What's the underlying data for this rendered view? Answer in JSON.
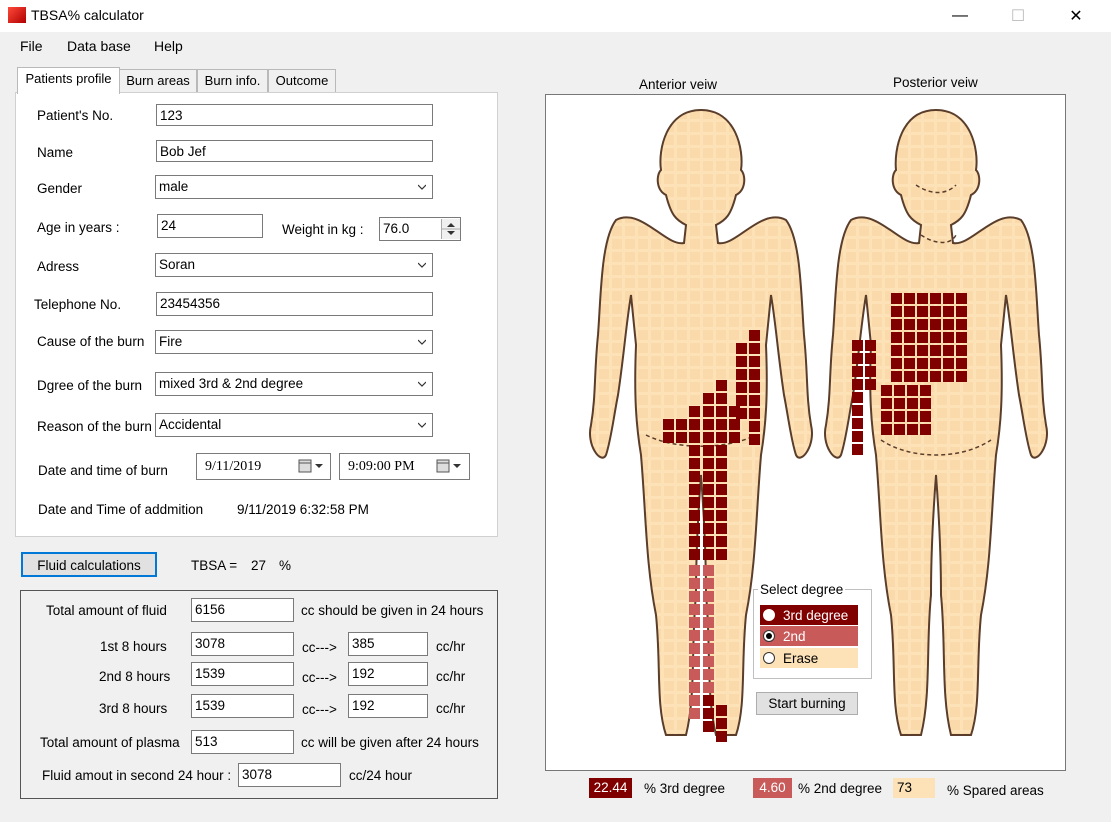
{
  "window": {
    "title": "TBSA% calculator",
    "minimize": "—",
    "maximize": "☐",
    "close": "✕"
  },
  "menu": {
    "file": "File",
    "database": "Data base",
    "help": "Help"
  },
  "tabs": {
    "profile": "Patients profile",
    "burn_areas": "Burn areas",
    "burn_info": "Burn info.",
    "outcome": "Outcome"
  },
  "profile": {
    "patient_no_label": "Patient's No.",
    "patient_no": "123",
    "name_label": "Name",
    "name": "Bob Jef",
    "gender_label": "Gender",
    "gender": "male",
    "age_label": "Age in years :",
    "age": "24",
    "weight_label": "Weight in kg :",
    "weight": "76.0",
    "address_label": "Adress",
    "address": "Soran",
    "telephone_label": "Telephone No.",
    "telephone": "23454356",
    "cause_label": "Cause of the burn",
    "cause": "Fire",
    "degree_label": "Dgree of the burn",
    "degree": "mixed 3rd & 2nd degree",
    "reason_label": "Reason of the burn",
    "reason": "Accidental",
    "burn_dt_label": "Date and time of burn",
    "burn_date": "9/11/2019",
    "burn_time": "9:09:00 PM",
    "admission_label": "Date and Time of addmition",
    "admission": "9/11/2019 6:32:58 PM"
  },
  "fluid": {
    "button": "Fluid calculations",
    "tbsa_label": "TBSA =",
    "tbsa_value": "27",
    "tbsa_unit": "%",
    "total_label": "Total amount of fluid",
    "total": "6156",
    "total_suffix": "cc should be given in 24 hours",
    "rows": [
      {
        "label": "1st 8 hours",
        "cc": "3078",
        "arrow": "cc--->",
        "rate": "385",
        "unit": "cc/hr"
      },
      {
        "label": "2nd 8 hours",
        "cc": "1539",
        "arrow": "cc--->",
        "rate": "192",
        "unit": "cc/hr"
      },
      {
        "label": "3rd 8 hours",
        "cc": "1539",
        "arrow": "cc--->",
        "rate": "192",
        "unit": "cc/hr"
      }
    ],
    "plasma_label": "Total amount of plasma",
    "plasma": "513",
    "plasma_suffix": "cc will be given after 24 hours",
    "second_label": "Fluid amout in second 24 hour :",
    "second": "3078",
    "second_unit": "cc/24 hour"
  },
  "body": {
    "anterior": "Anterior veiw",
    "posterior": "Posterior veiw",
    "select_degree": "Select degree",
    "opt3": "3rd degree",
    "opt2": "2nd",
    "erase": "Erase",
    "start": "Start burning"
  },
  "summary": {
    "third": "22.44",
    "third_label": "% 3rd degree",
    "second": "4.60",
    "second_label": "% 2nd degree",
    "spared": "73",
    "spared_label": "% Spared areas"
  },
  "colors": {
    "third": "#800000",
    "second": "#c85a5a",
    "skin": "#fde2b8",
    "spared": "#fde2b8"
  }
}
